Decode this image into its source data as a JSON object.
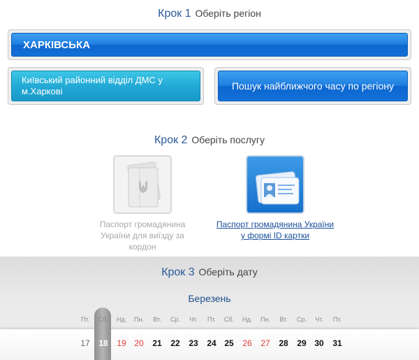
{
  "step1": {
    "num": "Крок 1",
    "text": "Оберіть регіон"
  },
  "region_select": {
    "value": "ХАРКІВСЬКА"
  },
  "office_button": {
    "label": "Київський районний відділ ДМС у м.Харкові"
  },
  "search_button": {
    "label": "Пошук найближчого часу по регіону"
  },
  "step2": {
    "num": "Крок 2",
    "text": "Оберіть послугу"
  },
  "services": [
    {
      "label": "Паспорт громадянина України для виїзду за кордон",
      "icon": "passport-icon",
      "active": false
    },
    {
      "label": "Паспорт громадянина України у формі ID картки",
      "icon": "id-card-icon",
      "active": true
    }
  ],
  "step3": {
    "num": "Крок 3",
    "text": "Оберіть дату"
  },
  "calendar": {
    "month": "Березень",
    "weekdays": [
      "Пт.",
      "Сб.",
      "Нд.",
      "Пн.",
      "Вт.",
      "Ср.",
      "Чт.",
      "Пт.",
      "Сб.",
      "Нд.",
      "Пн.",
      "Вт.",
      "Ср.",
      "Чт.",
      "Пт."
    ],
    "days": [
      "17",
      "18",
      "19",
      "20",
      "21",
      "22",
      "23",
      "24",
      "25",
      "26",
      "27",
      "28",
      "29",
      "30",
      "31"
    ],
    "selected_day": "18",
    "weekend_days": [
      "19",
      "20",
      "26",
      "27"
    ],
    "muted_days": [
      "17"
    ],
    "colors": {
      "weekend": "#e03a3a",
      "accent": "#1f7ee0",
      "selected_marker": "#a0a0a0"
    }
  }
}
